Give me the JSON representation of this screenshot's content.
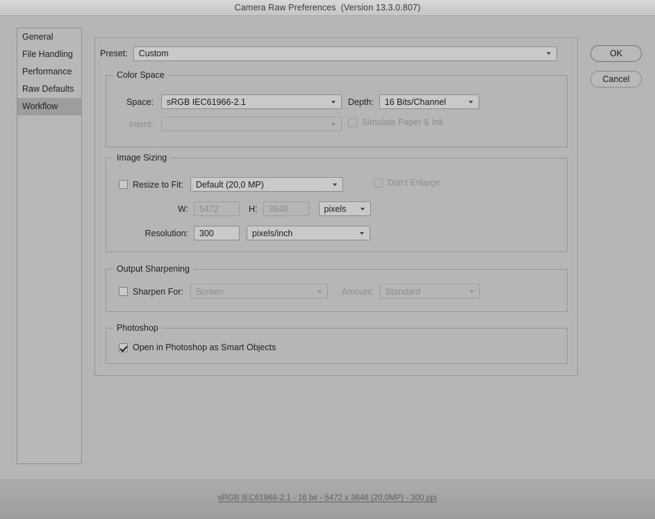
{
  "window": {
    "title": "Camera Raw Preferences  (Version 13.3.0.807)"
  },
  "sidebar": {
    "items": [
      {
        "label": "General",
        "selected": false
      },
      {
        "label": "File Handling",
        "selected": false
      },
      {
        "label": "Performance",
        "selected": false
      },
      {
        "label": "Raw Defaults",
        "selected": false
      },
      {
        "label": "Workflow",
        "selected": true
      }
    ]
  },
  "buttons": {
    "ok": "OK",
    "cancel": "Cancel"
  },
  "preset": {
    "label": "Preset:",
    "value": "Custom"
  },
  "color_space": {
    "legend": "Color Space",
    "space_label": "Space:",
    "space_value": "sRGB IEC61966-2.1",
    "depth_label": "Depth:",
    "depth_value": "16 Bits/Channel",
    "intent_label": "Intent:",
    "intent_value": "",
    "simulate_label": "Simulate Paper & Ink",
    "simulate_checked": false
  },
  "image_sizing": {
    "legend": "Image Sizing",
    "resize_label": "Resize to Fit:",
    "resize_checked": false,
    "resize_value": "Default  (20,0 MP)",
    "dont_enlarge_label": "Don’t Enlarge",
    "dont_enlarge_checked": false,
    "w_label": "W:",
    "w_value": "5472",
    "h_label": "H:",
    "h_value": "3648",
    "units_value": "pixels",
    "resolution_label": "Resolution:",
    "resolution_value": "300",
    "resolution_units": "pixels/inch"
  },
  "output_sharpening": {
    "legend": "Output Sharpening",
    "sharpen_label": "Sharpen For:",
    "sharpen_checked": false,
    "sharpen_value": "Screen",
    "amount_label": "Amount:",
    "amount_value": "Standard"
  },
  "photoshop": {
    "legend": "Photoshop",
    "smart_objects_label": "Open in Photoshop as Smart Objects",
    "smart_objects_checked": true
  },
  "footer": {
    "status": "sRGB IEC61966-2.1 - 16 bit - 5472 x 3648 (20,0MP) - 300 ppi"
  },
  "colors": {
    "window_bg": "#b6b6b6",
    "titlebar_bg": "#cfcfcf",
    "selection": "#9d9d9d",
    "control_bg": "#c9c9c9",
    "text": "#1e1e1e",
    "disabled_text": "#8d8d8d",
    "border": "#979797"
  }
}
